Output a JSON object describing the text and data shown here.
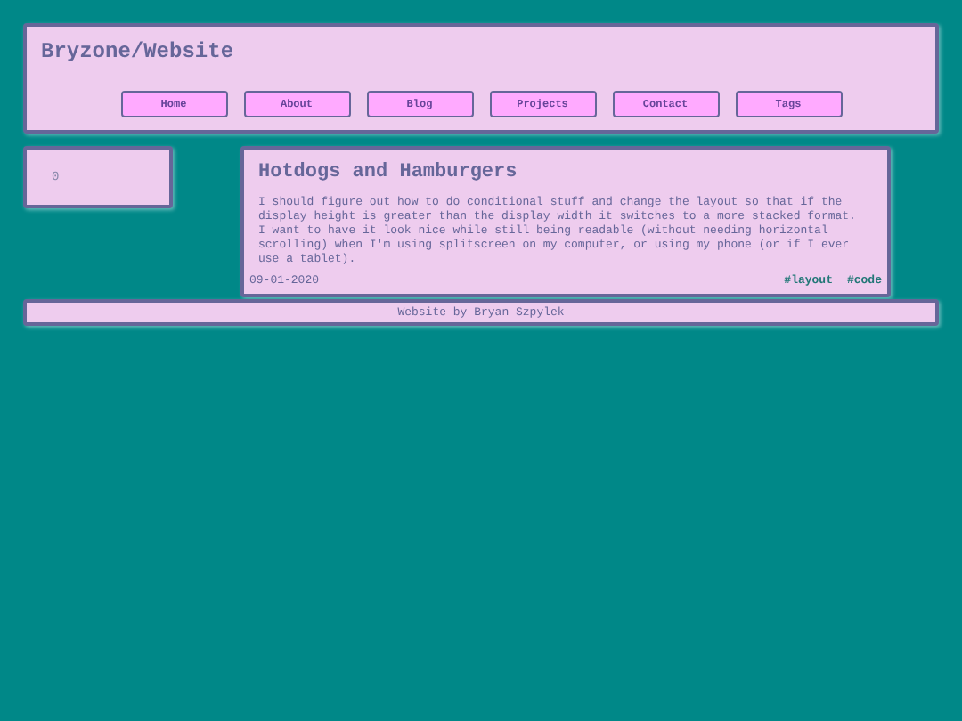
{
  "site_title": "Bryzone/Website",
  "nav": [
    {
      "label": "Home"
    },
    {
      "label": "About"
    },
    {
      "label": "Blog"
    },
    {
      "label": "Projects"
    },
    {
      "label": "Contact"
    },
    {
      "label": "Tags"
    }
  ],
  "sidebar": {
    "text": "0"
  },
  "post": {
    "title": "Hotdogs and Hamburgers",
    "body": "I should figure out how to do conditional stuff and change the layout so that if the display height is greater than the display width it switches to a more stacked format. I want to have it look nice while still being readable (without needing horizontal scrolling) when I'm using splitscreen on my computer, or using my phone (or if I ever use a tablet).",
    "date": "09-01-2020",
    "tags": [
      "#layout",
      "#code"
    ]
  },
  "footer": "Website by Bryan Szpylek"
}
